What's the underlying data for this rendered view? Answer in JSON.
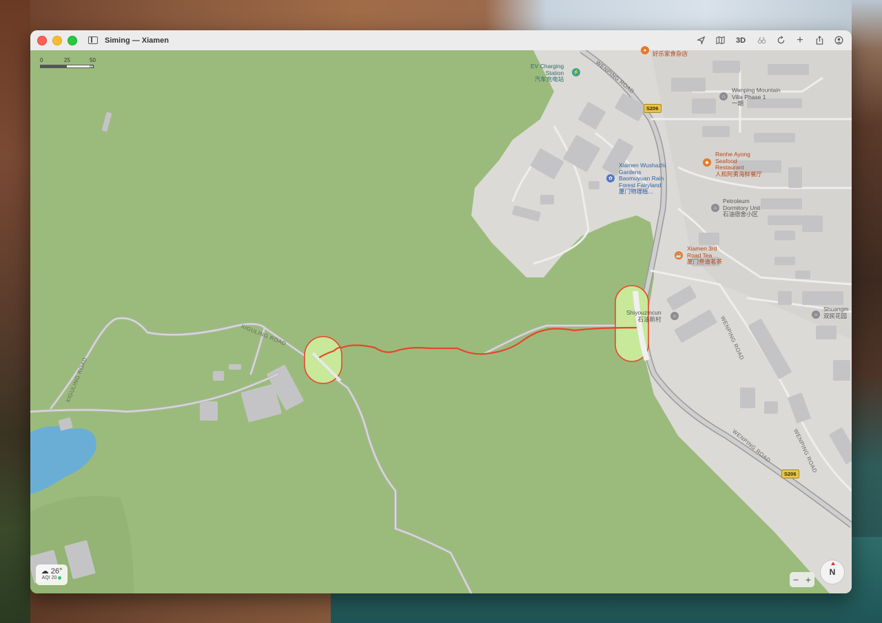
{
  "window": {
    "title": "Siming — Xiamen"
  },
  "toolbar": {
    "location_label": "location-arrow-icon",
    "map_mode_label": "map-icon",
    "threed_label": "3D",
    "lookaround_label": "binoculars-icon",
    "rotate_label": "rotate-icon",
    "add_label": "+",
    "share_label": "share-icon",
    "account_label": "person-icon"
  },
  "scale": {
    "t0": "0",
    "t1": "25",
    "t2": "50 m"
  },
  "roads": {
    "wenping_upper": "WENPING ROAD",
    "wenping_lower": "WENPING ROAD",
    "wenping_side": "WENPING ROAD",
    "wenping_far": "WENPING ROAD",
    "xiguling": "XIGULING ROAD",
    "xiguling_vertical": "XIGULING ROAD",
    "shield_top": "S206",
    "shield_bottom": "S206"
  },
  "pois": {
    "ev_charging": {
      "line1": "EV Charging",
      "line2": "Station",
      "line3": "汽车充电站"
    },
    "haolejia": {
      "line1": "好乐家食杂店"
    },
    "wenping_villa": {
      "line1": "Wenping Mountain",
      "line2": "Villa Phase 1",
      "line3": "一期"
    },
    "renhe": {
      "line1": "Renhe Ayong",
      "line2": "Seafood",
      "line3": "Restaurant",
      "line4": "人和阿勇海鲜餐厅"
    },
    "wushazhi": {
      "line1": "Xiamen Wushazhi",
      "line2": "Gardens",
      "line3": "Baomuyuan Rain",
      "line4": "Forest Fairyland",
      "line5": "厦门物理植..."
    },
    "petroleum": {
      "line1": "Petroleum",
      "line2": "Dormitory Unit",
      "line3": "石油宿舍小区"
    },
    "tea": {
      "line1": "Xiamen 3rd",
      "line2": "Road Tea",
      "line3": "厦门叁道茗茶"
    },
    "shiyouzincun": {
      "line1": "Shiyouzincun",
      "line2": "石油新村"
    },
    "shuangmin": {
      "line1": "Shuangm",
      "line2": "双民花园"
    }
  },
  "weather": {
    "temp": "26°",
    "aqi": "AQI 20"
  },
  "zoom": {
    "minus": "−",
    "plus": "+"
  },
  "compass": {
    "label": "N"
  },
  "colors": {
    "park": "#9bbb7c",
    "urban": "#dcdad6",
    "building": "#c4c4c6",
    "water": "#6aaed6",
    "route": "#e8452a",
    "highlight_stroke": "#e8452a",
    "highlight_fill": "#c8e89a"
  }
}
